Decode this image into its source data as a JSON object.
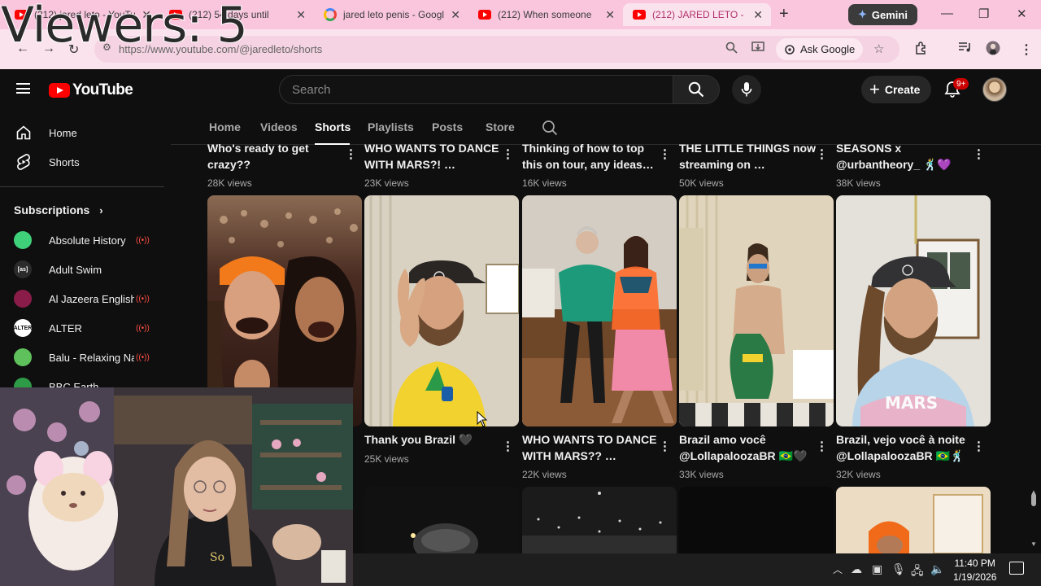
{
  "overlay": {
    "viewers_label": "Viewers: 5"
  },
  "browser": {
    "tabs": [
      {
        "title": "(212) jared leto - YouTube",
        "icon": "youtube-icon"
      },
      {
        "title": "(212) 54 days until",
        "icon": "youtube-icon"
      },
      {
        "title": "jared leto penis - Google Search",
        "icon": "google-icon"
      },
      {
        "title": "(212) When someone",
        "icon": "youtube-icon"
      },
      {
        "title": "(212) JARED LETO - YouTube",
        "icon": "youtube-icon",
        "active": true
      }
    ],
    "gemini_label": "Gemini",
    "url": "https://www.youtube.com/@jaredleto/shorts",
    "ask_google_label": "Ask Google",
    "colors": {
      "tabbar": "#f9c6de",
      "active_tab_text": "#b0306a"
    }
  },
  "youtube": {
    "logo_text": "YouTube",
    "search_placeholder": "Search",
    "create_label": "Create",
    "notification_badge": "9+",
    "sidebar": {
      "items": [
        {
          "label": "Home",
          "icon": "home-icon"
        },
        {
          "label": "Shorts",
          "icon": "shorts-icon"
        }
      ],
      "subscriptions_heading": "Subscriptions",
      "subscriptions": [
        {
          "name": "Absolute History",
          "color": "#3fd17a",
          "badge": ""
        },
        {
          "name": "Adult Swim",
          "color": "#2b2b2b",
          "badge": "[as]"
        },
        {
          "name": "Al Jazeera English",
          "color": "#8a1c4a",
          "badge": ""
        },
        {
          "name": "ALTER",
          "color": "#ffffff",
          "badge": "ALTER"
        },
        {
          "name": "Balu - Relaxing Nature",
          "color": "#5ec15b",
          "badge": ""
        },
        {
          "name": "BBC Earth",
          "color": "#2e9b46",
          "badge": ""
        }
      ]
    },
    "channel_tabs": [
      {
        "label": "Home"
      },
      {
        "label": "Videos"
      },
      {
        "label": "Shorts",
        "active": true
      },
      {
        "label": "Playlists"
      },
      {
        "label": "Posts"
      },
      {
        "label": "Store"
      }
    ],
    "shorts_rows": [
      {
        "items": [
          {
            "title": "Who's ready to get crazy??",
            "views": "28K views"
          },
          {
            "title": "WHO WANTS TO DANCE WITH MARS?! …",
            "views": "23K views"
          },
          {
            "title": "Thinking of how to top this on tour, any ideas…",
            "views": "16K views"
          },
          {
            "title": "THE LITTLE THINGS now streaming on …",
            "views": "50K views"
          },
          {
            "title": "SEASONS x @urbantheory_ 🕺💜",
            "views": "38K views"
          }
        ]
      },
      {
        "items": [
          {
            "title": "Thank you Brazil 🖤",
            "views": "25K views",
            "thumb": "crowd"
          },
          {
            "title": "WHO WANTS TO DANCE WITH MARS?? …",
            "views": "22K views",
            "thumb": "peace"
          },
          {
            "title": "Brazil amo você @LollapaloozaBR 🇧🇷🖤",
            "views": "33K views",
            "thumb": "dance"
          },
          {
            "title": "Brazil, vejo você à noite @LollapaloozaBR 🇧🇷🕺",
            "views": "32K views",
            "thumb": "shirtless"
          },
          {
            "title": "",
            "views": "",
            "thumb": "selfie"
          }
        ]
      }
    ]
  },
  "taskbar": {
    "time": "11:40 PM",
    "date": "1/19/2026"
  }
}
